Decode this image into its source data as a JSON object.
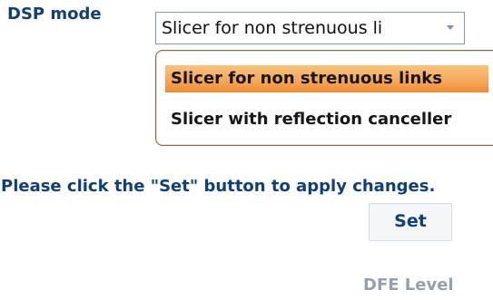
{
  "settings": {
    "dsp_mode_label": "DSP mode",
    "dsp_mode_selected": "Slicer for non strenuous li",
    "dropdown_options": [
      "Slicer for non strenuous links",
      "Slicer with reflection canceller"
    ],
    "apply_hint": "Please click the \"Set\" button to apply changes.",
    "set_button_label": "Set",
    "dfe_level_label": "DFE Level"
  }
}
